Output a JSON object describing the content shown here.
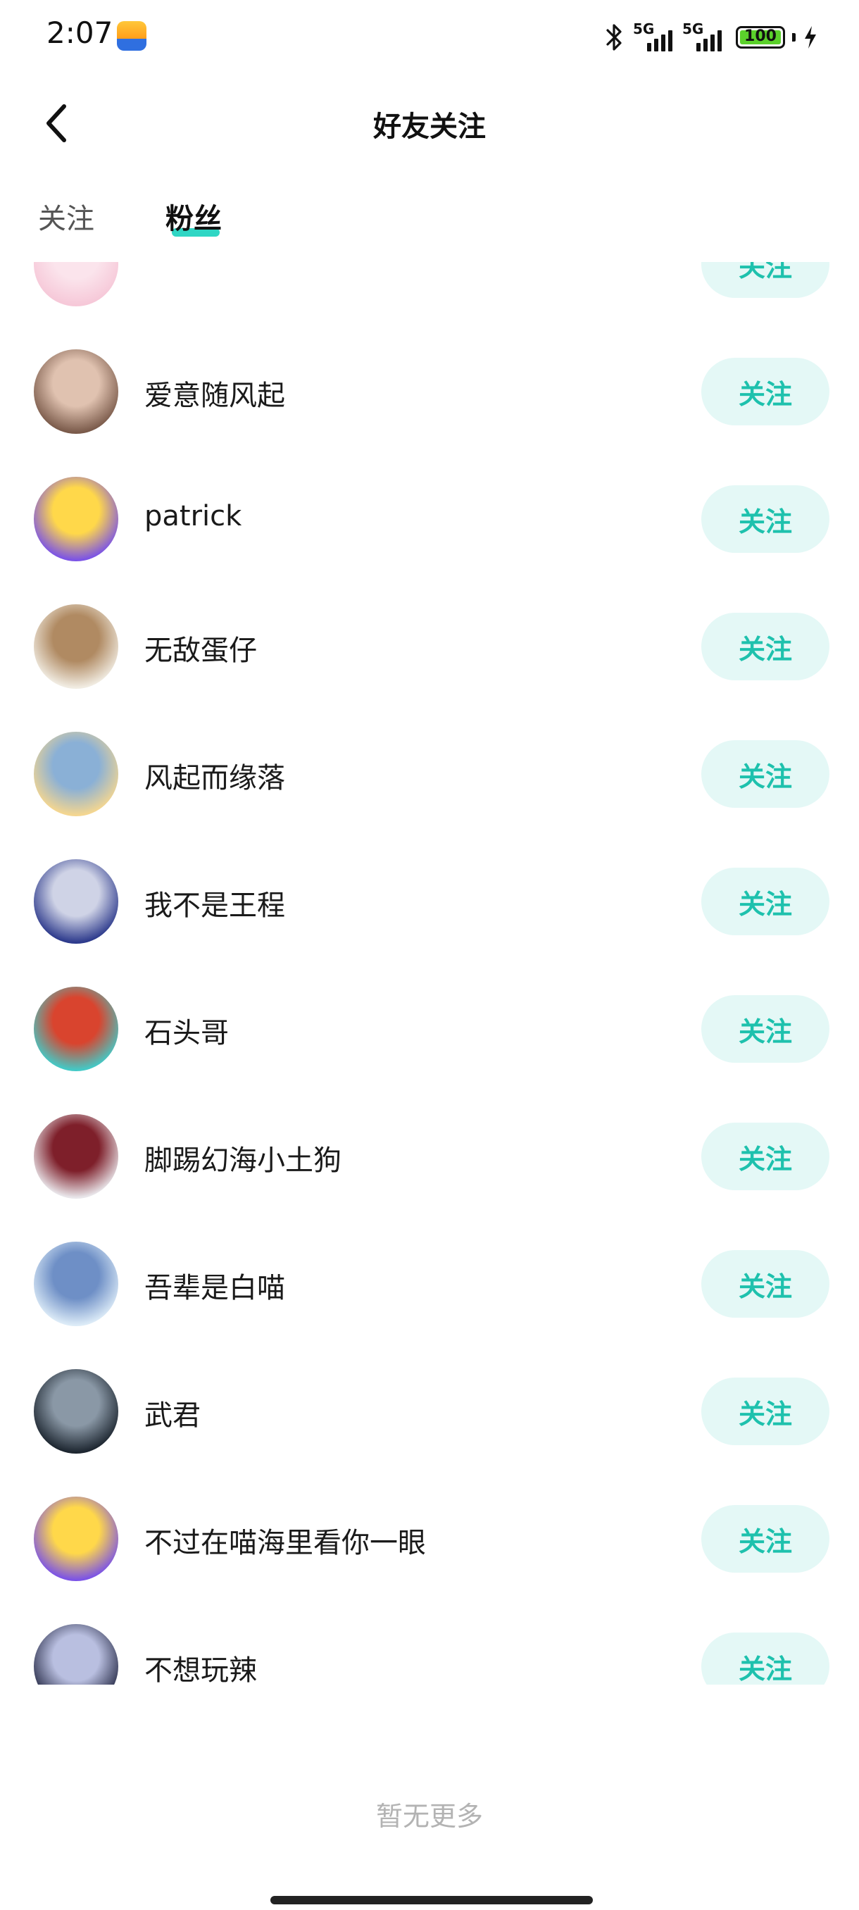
{
  "status_bar": {
    "time": "2:07",
    "network_1": "5G",
    "network_2": "5G",
    "battery_level": "100",
    "battery_color": "#5bd12b"
  },
  "header": {
    "title": "好友关注",
    "back_icon": "chevron-left-icon"
  },
  "tabs": [
    {
      "label": "关注",
      "active": false
    },
    {
      "label": "粉丝",
      "active": true
    }
  ],
  "accent_color": "#2fd6c4",
  "followers": [
    {
      "name": "",
      "button": "关注",
      "avatar_colors": [
        "#f6c8d8",
        "#fbe4ec"
      ]
    },
    {
      "name": "爱意随风起",
      "button": "关注",
      "avatar_colors": [
        "#7a5a4a",
        "#e0c2b0"
      ]
    },
    {
      "name": "patrick",
      "button": "关注",
      "avatar_colors": [
        "#7b53e6",
        "#ffd84a"
      ]
    },
    {
      "name": "无敌蛋仔",
      "button": "关注",
      "avatar_colors": [
        "#f1ece2",
        "#b08a62"
      ]
    },
    {
      "name": "风起而缘落",
      "button": "关注",
      "avatar_colors": [
        "#f4d690",
        "#8ab0d6"
      ]
    },
    {
      "name": "我不是王程",
      "button": "关注",
      "avatar_colors": [
        "#2d3a8c",
        "#cfd3e6"
      ]
    },
    {
      "name": "石头哥",
      "button": "关注",
      "avatar_colors": [
        "#43c9c6",
        "#d9442e"
      ]
    },
    {
      "name": "脚踢幻海小土狗",
      "button": "关注",
      "avatar_colors": [
        "#e9e6ea",
        "#7e1f2a"
      ]
    },
    {
      "name": "吾辈是白喵",
      "button": "关注",
      "avatar_colors": [
        "#dcebf7",
        "#6e8fc6"
      ]
    },
    {
      "name": "武君",
      "button": "关注",
      "avatar_colors": [
        "#1d2630",
        "#8a98a6"
      ]
    },
    {
      "name": "不过在喵海里看你一眼",
      "button": "关注",
      "avatar_colors": [
        "#7b53e6",
        "#ffd84a"
      ]
    },
    {
      "name": "不想玩辣",
      "button": "关注",
      "avatar_colors": [
        "#2a2e4a",
        "#b9bfe0"
      ]
    }
  ],
  "footer": {
    "no_more_text": "暂无更多"
  }
}
